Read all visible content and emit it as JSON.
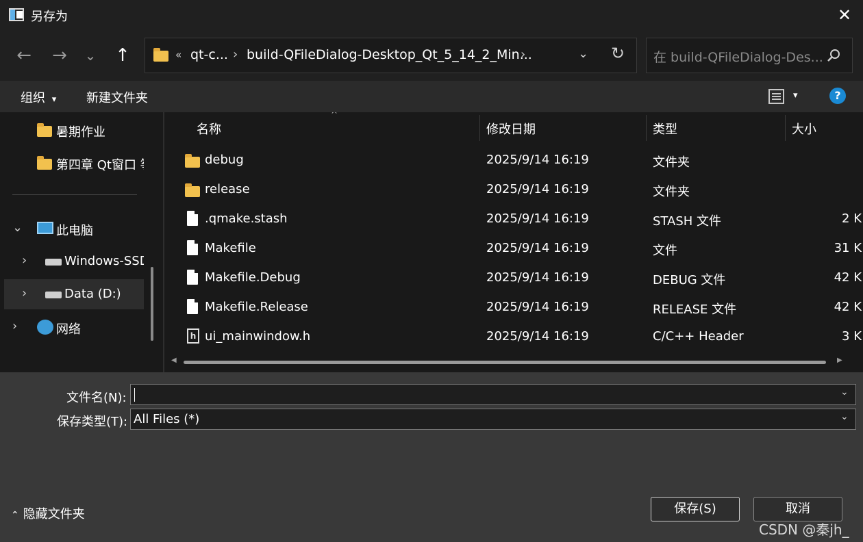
{
  "window": {
    "title": "另存为",
    "close": "✕"
  },
  "nav": {
    "back": "←",
    "forward": "→",
    "recent": "⌄",
    "up": "↑",
    "address": {
      "overflow": "«",
      "crumbs": [
        "qt-c...",
        "build-QFileDialog-Desktop_Qt_5_14_2_Min..."
      ],
      "sep": "›",
      "dropdown": "⌄",
      "refresh": "↻"
    },
    "search_placeholder": "在 build-QFileDialog-Des..."
  },
  "toolbar": {
    "organize": "组织",
    "new_folder": "新建文件夹",
    "dropdown": "▾",
    "help": "?"
  },
  "sidebar": {
    "items": [
      {
        "label": "暑期作业"
      },
      {
        "label": "第四章 Qt窗口 筝"
      },
      {
        "label": "此电脑",
        "arrow": "⌄"
      },
      {
        "label": "Windows-SSD",
        "arrow": "›"
      },
      {
        "label": "Data (D:)",
        "arrow": "›"
      },
      {
        "label": "网络",
        "arrow": "›"
      }
    ]
  },
  "columns": {
    "name": "名称",
    "modified": "修改日期",
    "type": "类型",
    "size": "大小",
    "sort_indicator": "^"
  },
  "files": [
    {
      "name": "debug",
      "modified": "2025/9/14 16:19",
      "type": "文件夹",
      "size": "",
      "icon": "folder-icon"
    },
    {
      "name": "release",
      "modified": "2025/9/14 16:19",
      "type": "文件夹",
      "size": "",
      "icon": "folder-icon"
    },
    {
      "name": ".qmake.stash",
      "modified": "2025/9/14 16:19",
      "type": "STASH 文件",
      "size": "2 K",
      "icon": "file-icon"
    },
    {
      "name": "Makefile",
      "modified": "2025/9/14 16:19",
      "type": "文件",
      "size": "31 K",
      "icon": "file-icon"
    },
    {
      "name": "Makefile.Debug",
      "modified": "2025/9/14 16:19",
      "type": "DEBUG 文件",
      "size": "42 K",
      "icon": "file-icon"
    },
    {
      "name": "Makefile.Release",
      "modified": "2025/9/14 16:19",
      "type": "RELEASE 文件",
      "size": "42 K",
      "icon": "file-icon"
    },
    {
      "name": "ui_mainwindow.h",
      "modified": "2025/9/14 16:19",
      "type": "C/C++ Header",
      "size": "3 K",
      "icon": "header-file-icon"
    }
  ],
  "form": {
    "filename_label": "文件名(N):",
    "filename_value": "",
    "filetype_label": "保存类型(T):",
    "filetype_value": "All Files  (*)",
    "dropdown": "⌄"
  },
  "footer": {
    "hide_folders": "隐藏文件夹",
    "hide_arrow": "⌃",
    "save": "保存(S)",
    "cancel": "取消",
    "watermark": "CSDN @秦jh_"
  },
  "colors": {
    "folder": "#f2c14e",
    "help": "#1a8ad4",
    "background": "#191919"
  }
}
